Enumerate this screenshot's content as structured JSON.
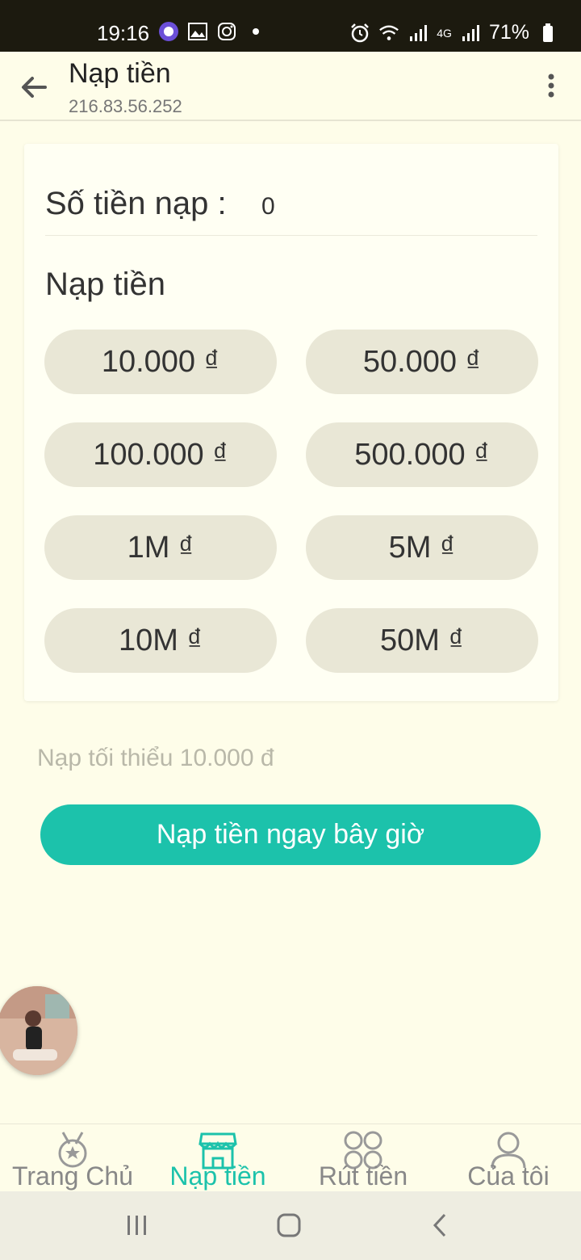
{
  "status_bar": {
    "time": "19:16",
    "battery": "71%",
    "network": "4G",
    "icons": [
      "app-notification-icon",
      "gallery-icon",
      "instagram-icon",
      "dot-icon",
      "alarm-icon",
      "wifi-icon",
      "signal-icon",
      "battery-icon"
    ]
  },
  "header": {
    "title": "Nạp tiền",
    "subtitle": "216.83.56.252"
  },
  "form": {
    "amount_label": "Số tiền nạp :",
    "amount_value": "0",
    "section_title": "Nạp tiền",
    "amounts": [
      "10.000 ₫",
      "50.000 ₫",
      "100.000 ₫",
      "500.000 ₫",
      "1M ₫",
      "5M ₫",
      "10M ₫",
      "50M ₫"
    ],
    "min_note": "Nạp tối thiểu 10.000 đ",
    "submit_label": "Nạp tiền ngay bây giờ"
  },
  "bottom_nav": {
    "items": [
      {
        "label": "Trang Chủ",
        "icon": "medal-icon"
      },
      {
        "label": "Nạp tiền",
        "icon": "store-icon"
      },
      {
        "label": "Rút tiền",
        "icon": "grid-icon"
      },
      {
        "label": "Của tôi",
        "icon": "user-icon"
      }
    ],
    "active_index": 1
  },
  "colors": {
    "accent": "#1cc2ab",
    "background": "#fefde9",
    "chip": "#e9e7d6"
  }
}
